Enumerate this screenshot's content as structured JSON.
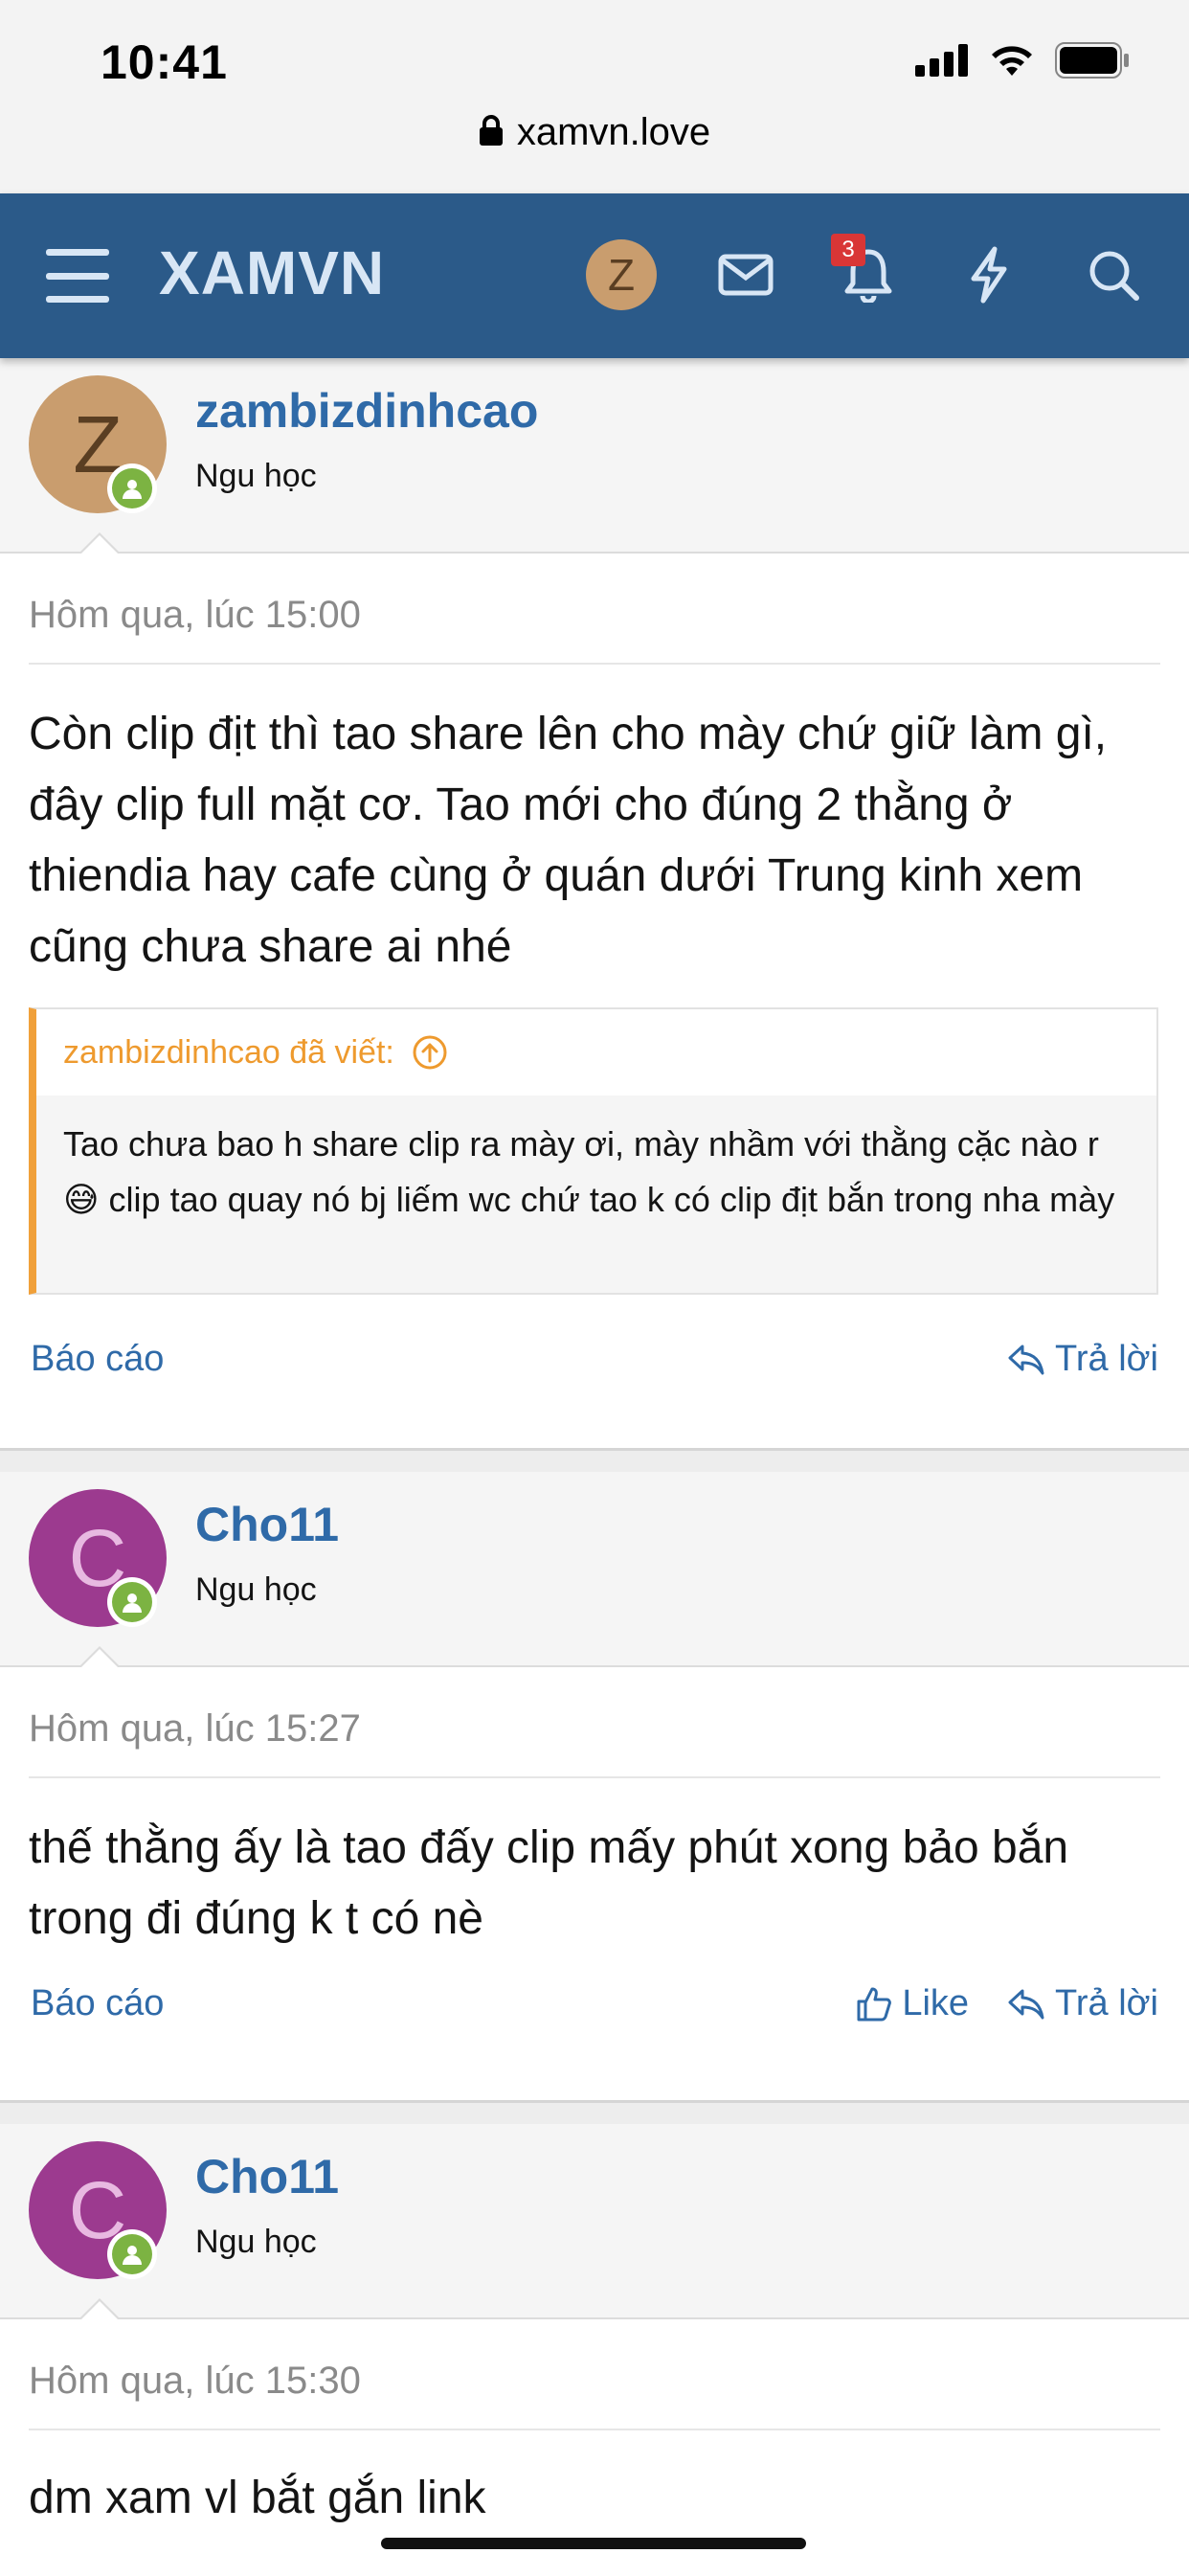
{
  "status": {
    "time": "10:41"
  },
  "browser": {
    "url": "xamvn.love"
  },
  "nav": {
    "brand": "XAMVN",
    "avatar_letter": "Z",
    "notification_count": "3"
  },
  "posts": [
    {
      "avatar_letter": "Z",
      "avatar_color": "#c99d6e",
      "avatar_text_color": "#5a3e22",
      "username": "zambizdinhcao",
      "user_title": "Ngu học",
      "date": "Hôm qua, lúc 15:00",
      "message": "Còn clip địt thì tao share lên cho mày chứ giữ làm gì, đây clip full mặt cơ. Tao mới cho đúng 2 thằng ở thiendia hay cafe cùng ở quán dưới Trung kinh xem cũng chưa share ai nhé",
      "quote": {
        "author": "zambizdinhcao đã viết:",
        "text_before_emoji": "Tao chưa bao h share clip ra mày ơi, mày nhầm với thằng cặc nào r",
        "emoji": "😅",
        "text_after_emoji": "clip tao quay nó bj liếm wc chứ tao k có clip địt bắn trong nha mày"
      },
      "report_label": "Báo cáo",
      "reply_label": "Trả lời"
    },
    {
      "avatar_letter": "C",
      "avatar_color": "#9c3a8f",
      "avatar_text_color": "#e8b9e1",
      "username": "Cho11",
      "user_title": "Ngu học",
      "date": "Hôm qua, lúc 15:27",
      "message": "thế thằng ấy là tao đấy clip mấy phút xong bảo bắn trong đi đúng k t có nè",
      "report_label": "Báo cáo",
      "like_label": "Like",
      "reply_label": "Trả lời"
    },
    {
      "avatar_letter": "C",
      "avatar_color": "#9c3a8f",
      "avatar_text_color": "#e8b9e1",
      "username": "Cho11",
      "user_title": "Ngu học",
      "date": "Hôm qua, lúc 15:30",
      "message": "dm xam vl bắt gắn link"
    }
  ],
  "colors": {
    "nav_bg": "#2b5a89",
    "link": "#2f6aa8",
    "quote_accent": "#f0a03a",
    "online": "#7cb342",
    "badge": "#d93636"
  }
}
